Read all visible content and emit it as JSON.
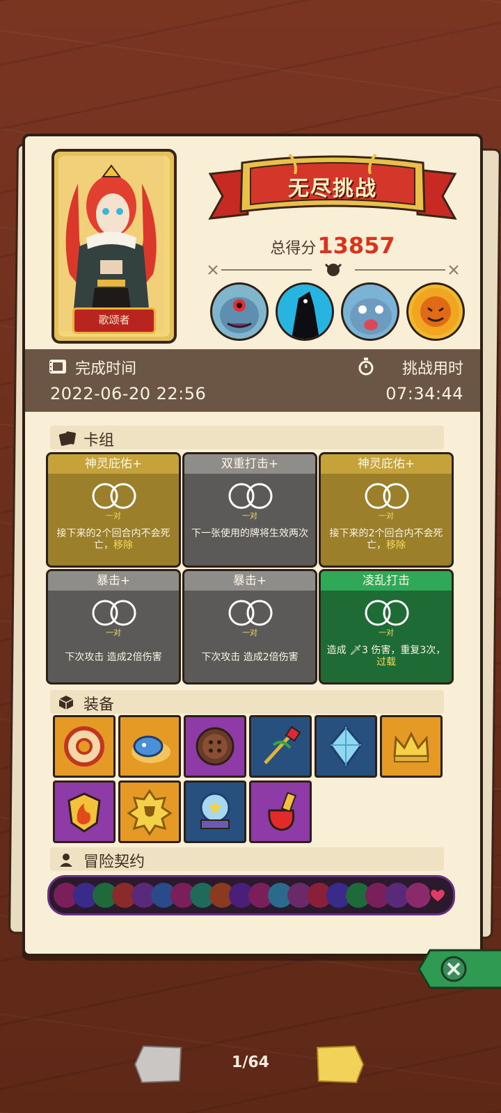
{
  "mode_title": "无尽挑战",
  "score": {
    "label": "总得分",
    "value": "13857"
  },
  "hero": {
    "name": "歌颂者"
  },
  "bosses": [
    "boss-1",
    "boss-2",
    "boss-3",
    "boss-4"
  ],
  "stats": {
    "complete_label": "完成时间",
    "complete_value": "2022-06-20 22:56",
    "duration_label": "挑战用时",
    "duration_value": "07:34:44"
  },
  "deck": {
    "title": "卡组",
    "cards": [
      {
        "name": "神灵庇佑+",
        "pair": "一对",
        "desc": "接下来的2个回合内不会死亡，",
        "kw": "移除",
        "style": "gold"
      },
      {
        "name": "双重打击+",
        "pair": "一对",
        "desc": "下一张使用的牌将生效两次",
        "kw": "",
        "style": "grey"
      },
      {
        "name": "神灵庇佑+",
        "pair": "一对",
        "desc": "接下来的2个回合内不会死亡，",
        "kw": "移除",
        "style": "gold"
      },
      {
        "name": "暴击+",
        "pair": "一对",
        "desc": "下次攻击 造成2倍伤害",
        "kw": "",
        "style": "grey"
      },
      {
        "name": "暴击+",
        "pair": "一对",
        "desc": "下次攻击 造成2倍伤害",
        "kw": "",
        "style": "grey"
      },
      {
        "name": "凌乱打击",
        "pair": "一对",
        "desc": "造成 🗡3 伤害，重复3次，",
        "kw": "过载",
        "style": "green"
      }
    ]
  },
  "equipment": {
    "title": "装备",
    "items": [
      {
        "icon": "donut-ring-icon",
        "color": "orange"
      },
      {
        "icon": "blue-slime-icon",
        "color": "orange"
      },
      {
        "icon": "button-coin-icon",
        "color": "purple"
      },
      {
        "icon": "ruby-staff-icon",
        "color": "blue"
      },
      {
        "icon": "diamond-gem-icon",
        "color": "blue"
      },
      {
        "icon": "gold-crown-icon",
        "color": "orange"
      },
      {
        "icon": "fire-shield-icon",
        "color": "purple"
      },
      {
        "icon": "trophy-badge-icon",
        "color": "orange"
      },
      {
        "icon": "crystal-ball-icon",
        "color": "blue"
      },
      {
        "icon": "red-potion-icon",
        "color": "purple"
      }
    ]
  },
  "contracts": {
    "title": "冒险契约"
  },
  "pager": {
    "current": "1/64"
  }
}
